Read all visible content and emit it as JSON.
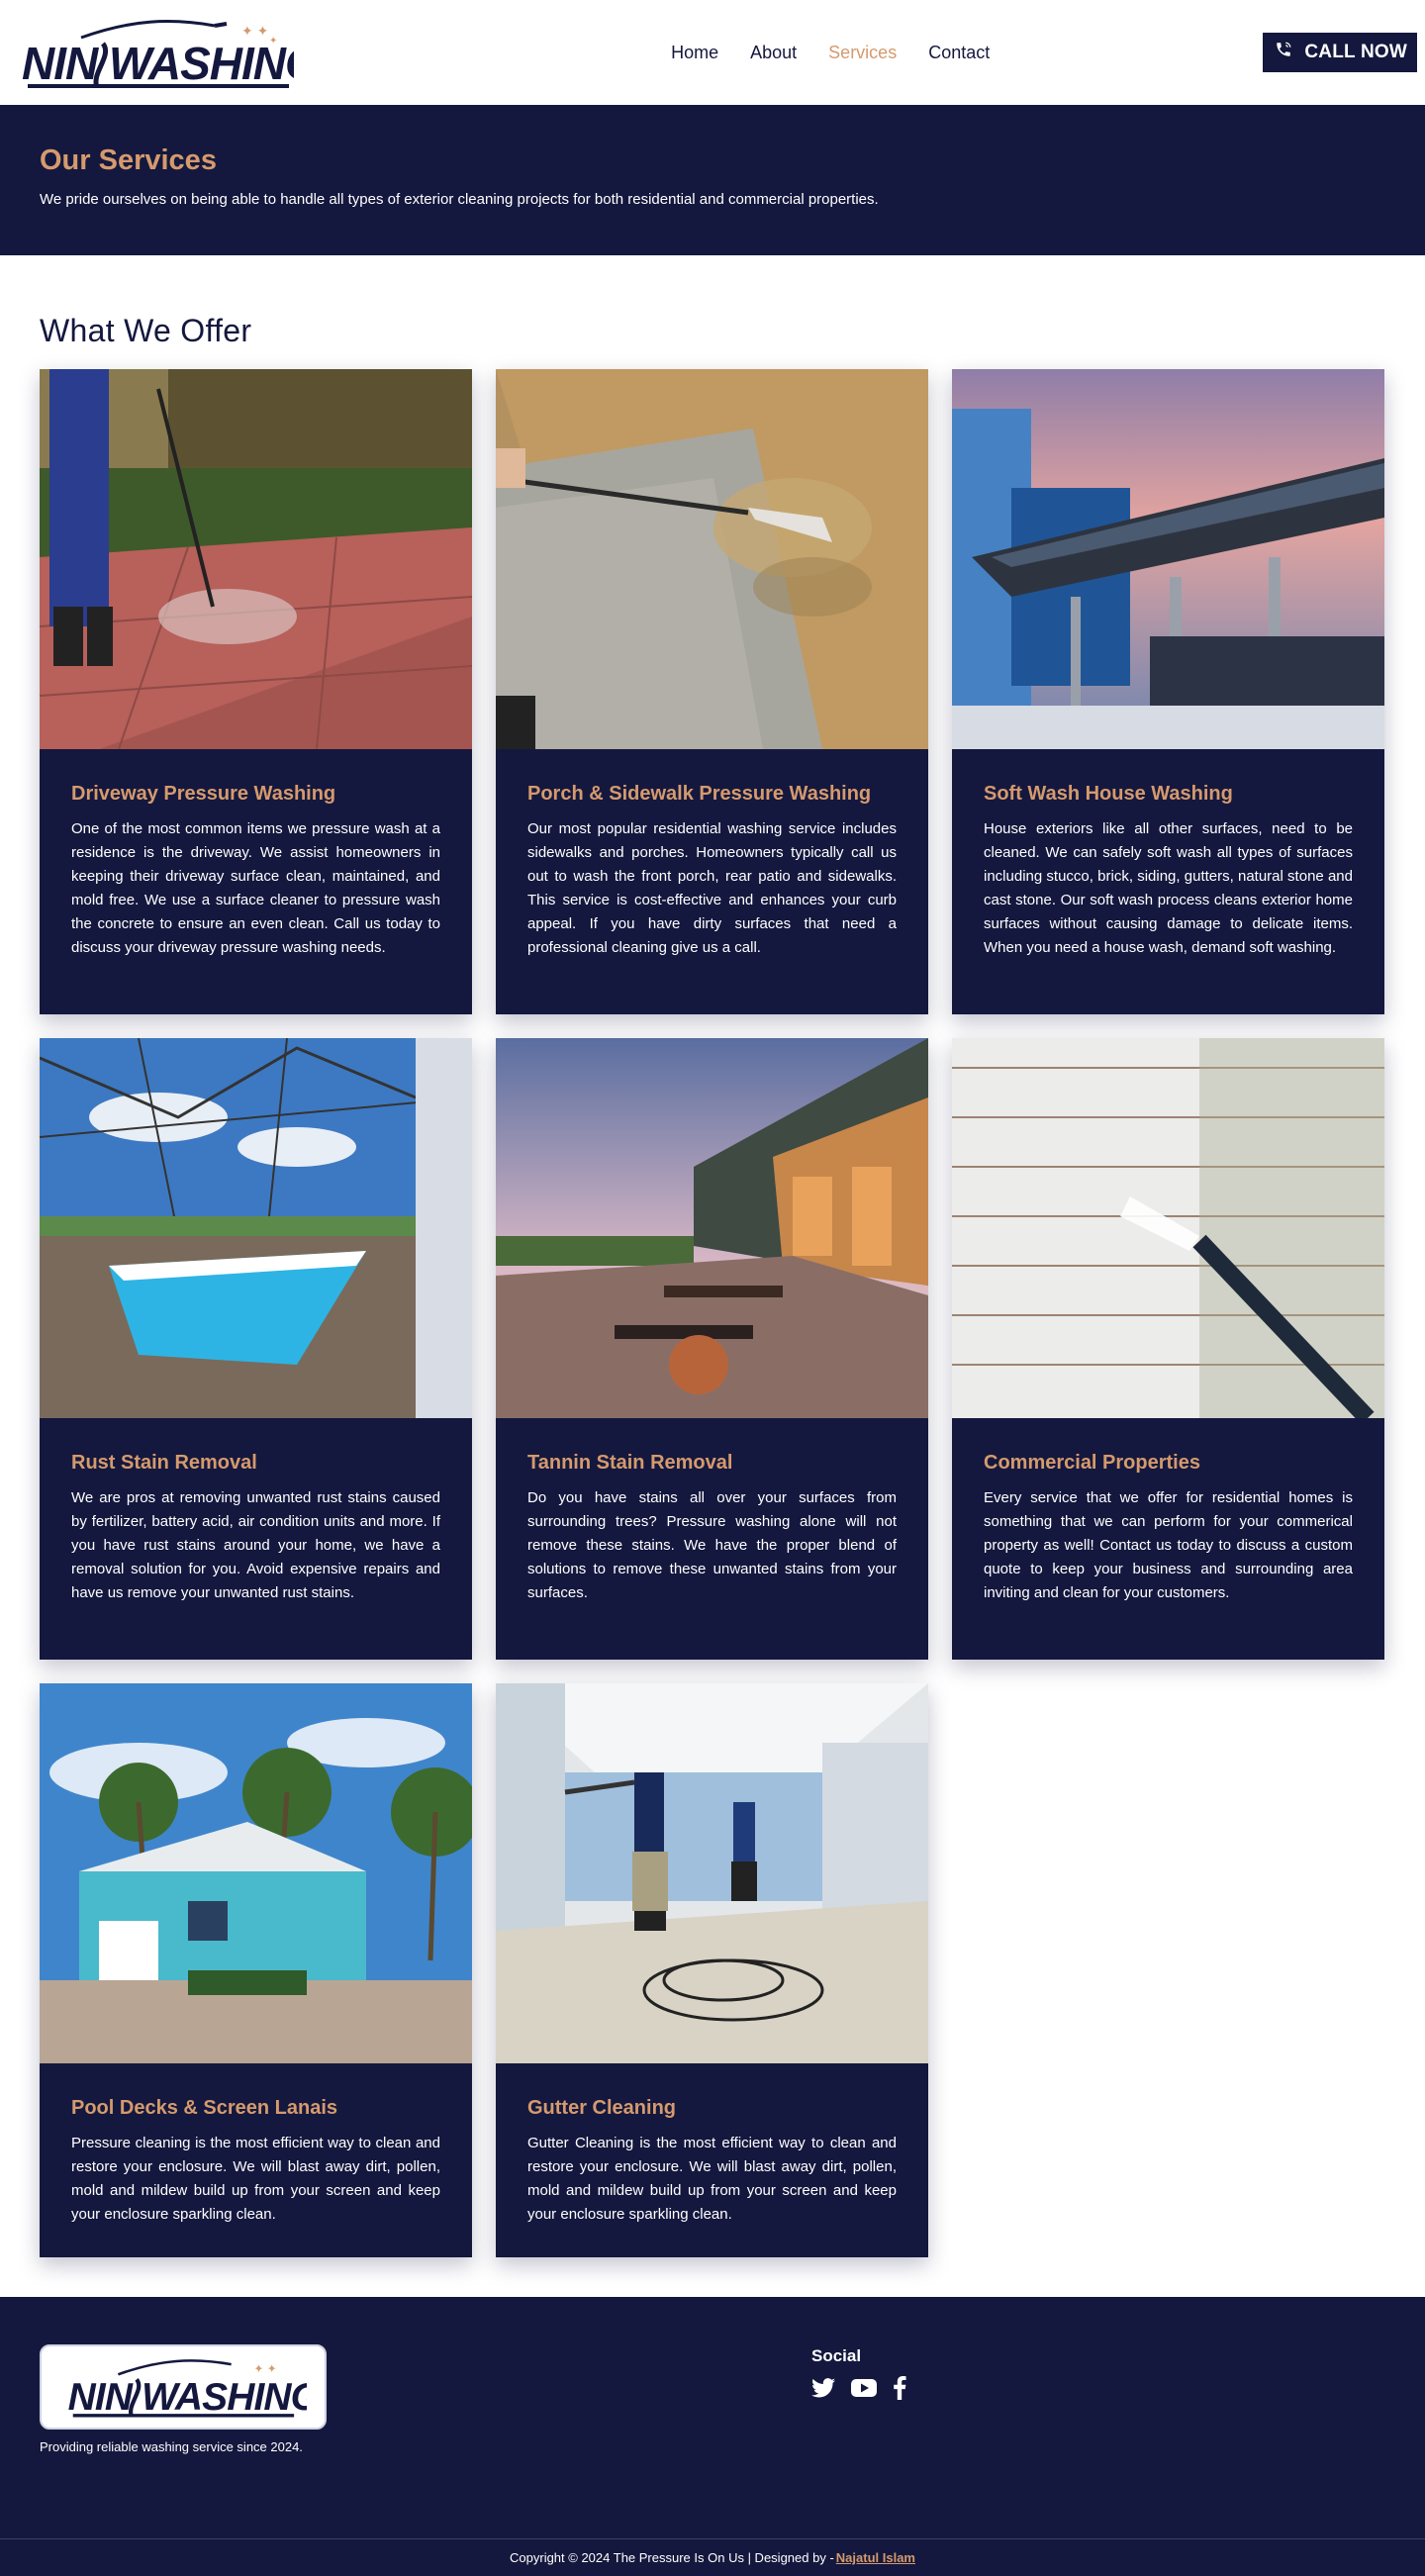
{
  "brand": {
    "logo_text": "NINJWASHING",
    "accent": "#d59a6d",
    "primary": "#14183e"
  },
  "nav": {
    "items": [
      {
        "label": "Home"
      },
      {
        "label": "About"
      },
      {
        "label": "Services",
        "active": true
      },
      {
        "label": "Contact"
      }
    ],
    "cta_label": "CALL NOW",
    "cta_icon": "phone-icon"
  },
  "hero": {
    "title": "Our Services",
    "subtitle": "We pride ourselves on being able to handle all types of exterior cleaning projects for both residential and commercial properties."
  },
  "offer": {
    "heading": "What We Offer",
    "services": [
      {
        "title": "Driveway Pressure Washing",
        "text": "One of the most common items we pressure wash at a residence is the driveway. We assist homeowners in keeping their driveway surface clean, maintained, and mold free. We use a surface cleaner to pressure wash the concrete to ensure an even clean. Call us today to discuss your driveway pressure washing needs."
      },
      {
        "title": "Porch & Sidewalk Pressure Washing",
        "text": "Our most popular residential washing service includes sidewalks and porches. Homeowners typically call us out to wash the front porch, rear patio and sidewalks. This service is cost-effective and enhances your curb appeal. If you have dirty surfaces that need a professional cleaning give us a call."
      },
      {
        "title": "Soft Wash House Washing",
        "text": "House exteriors like all other surfaces, need to be cleaned. We can safely soft wash all types of surfaces including stucco, brick, siding, gutters, natural stone and cast stone. Our soft wash process cleans exterior home surfaces without causing damage to delicate items. When you need a house wash, demand soft washing."
      },
      {
        "title": "Rust Stain Removal",
        "text": "We are pros at removing unwanted rust stains caused by fertilizer, battery acid, air condition units and more. If you have rust stains around your home, we have a removal solution for you. Avoid expensive repairs and have us remove your unwanted rust stains."
      },
      {
        "title": "Tannin Stain Removal",
        "text": "Do you have stains all over your surfaces from surrounding trees? Pressure washing alone will not remove these stains. We have the proper blend of solutions to remove these unwanted stains from your surfaces."
      },
      {
        "title": "Commercial Properties",
        "text": "Every service that we offer for residential homes is something that we can perform for your commerical property as well! Contact us today to discuss a custom quote to keep your business and surrounding area inviting and clean for your customers."
      },
      {
        "title": "Pool Decks & Screen Lanais",
        "text": "Pressure cleaning is the most efficient way to clean and restore your enclosure. We will blast away dirt, pollen, mold and mildew build up from your screen and keep your enclosure sparkling clean."
      },
      {
        "title": "Gutter Cleaning",
        "text": "Gutter Cleaning is the most efficient way to clean and restore your enclosure. We will blast away dirt, pollen, mold and mildew build up from your screen and keep your enclosure sparkling clean."
      }
    ]
  },
  "footer": {
    "tagline": "Providing reliable washing service since 2024.",
    "social_heading": "Social",
    "social_icons": [
      "twitter-icon",
      "youtube-icon",
      "facebook-icon"
    ],
    "copyright": "Copyright © 2024 The Pressure Is On Us | Designed by -",
    "designer": "Najatul Islam"
  }
}
